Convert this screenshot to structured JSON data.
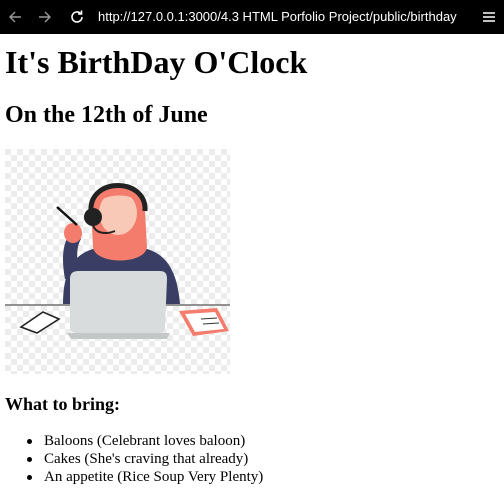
{
  "browser": {
    "url": "http://127.0.0.1:3000/4.3 HTML Porfolio Project/public/birthday",
    "icons": [
      "back-arrow-icon",
      "forward-arrow-icon",
      "reload-icon",
      "menu-icon"
    ]
  },
  "page": {
    "title": "It's BirthDay O'Clock",
    "date": "On the 12th of June",
    "illustration": "woman-with-headset-at-laptop-illustration",
    "bring_heading": "What to bring:",
    "bring_items": [
      "Baloons (Celebrant loves baloon)",
      "Cakes (She's craving that already)",
      "An appetite (Rice Soup Very Plenty)"
    ]
  },
  "colors": {
    "topbar": "#000000",
    "skin": "#f47c6c",
    "jacket": "#3b3e64",
    "laptop": "#d9dcdc"
  }
}
